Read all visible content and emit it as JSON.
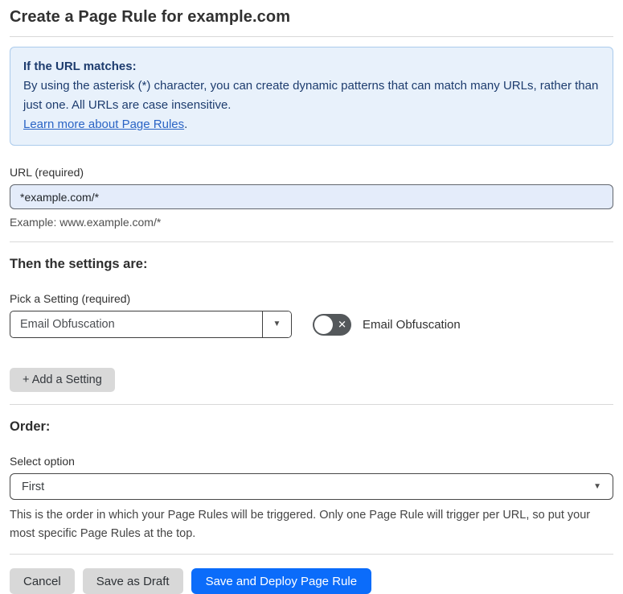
{
  "page": {
    "title": "Create a Page Rule for example.com"
  },
  "info_box": {
    "heading": "If the URL matches:",
    "body": "By using the asterisk (*) character, you can create dynamic patterns that can match many URLs, rather than just one. All URLs are case insensitive.",
    "link": "Learn more about Page Rules",
    "link_suffix": "."
  },
  "url_field": {
    "label": "URL (required)",
    "value": "*example.com/*",
    "example": "Example: www.example.com/*"
  },
  "settings_section": {
    "heading": "Then the settings are:",
    "pick_label": "Pick a Setting (required)",
    "selected_setting": "Email Obfuscation",
    "dropdown_arrow": "▼",
    "toggle_state": "off",
    "toggle_x": "✕",
    "toggle_label": "Email Obfuscation",
    "add_button": "+ Add a Setting"
  },
  "order_section": {
    "heading": "Order:",
    "select_label": "Select option",
    "selected_option": "First",
    "dropdown_arrow": "▼",
    "help_text": "This is the order in which your Page Rules will be triggered. Only one Page Rule will trigger per URL, so put your most specific Page Rules at the top."
  },
  "footer": {
    "cancel": "Cancel",
    "save_draft": "Save as Draft",
    "save_deploy": "Save and Deploy Page Rule"
  },
  "colors": {
    "primary_blue": "#0b6cfa",
    "info_bg": "#e8f1fb",
    "info_border": "#abcbec",
    "info_text": "#1d3c6e",
    "link_blue": "#2a64c5",
    "input_autofill_bg": "#e4ecfa",
    "toggle_off_bg": "#54585b",
    "button_gray": "#d8d8d8"
  }
}
